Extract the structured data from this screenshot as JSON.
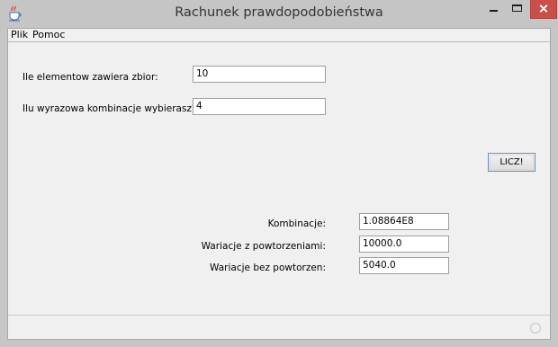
{
  "window": {
    "title": "Rachunek prawdopodobieństwa",
    "icon": "java-cup-icon",
    "close_color": "#c7504a"
  },
  "menu": {
    "items": [
      "Plik",
      "Pomoc"
    ]
  },
  "form": {
    "elements_label": "Ile elementow zawiera zbior:",
    "elements_value": "10",
    "choose_label": "Ilu wyrazowa kombinacje wybierasz?",
    "choose_value": "4",
    "compute_button": "LICZ!"
  },
  "results": {
    "combinations_label": "Kombinacje:",
    "combinations_value": "1.08864E8",
    "variations_rep_label": "Wariacje z powtorzeniami:",
    "variations_rep_value": "10000.0",
    "variations_norep_label": "Wariacje bez powtorzen:",
    "variations_norep_value": "5040.0"
  }
}
